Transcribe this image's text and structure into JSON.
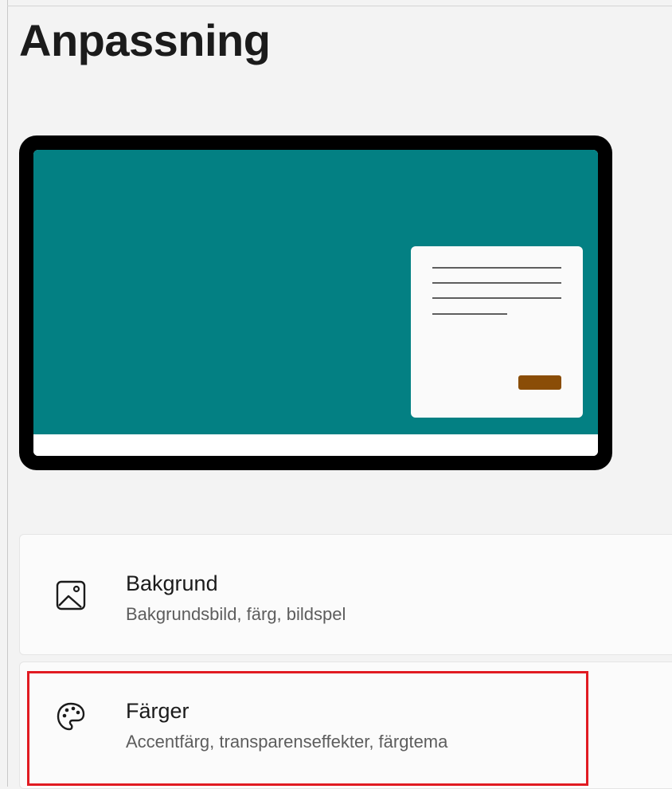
{
  "page": {
    "title": "Anpassning"
  },
  "preview": {
    "desktop_color": "#038083",
    "accent_button_color": "#8a4d07"
  },
  "settings": [
    {
      "title": "Bakgrund",
      "description": "Bakgrundsbild, färg, bildspel",
      "icon": "image-icon"
    },
    {
      "title": "Färger",
      "description": "Accentfärg, transparenseffekter, färgtema",
      "icon": "palette-icon",
      "highlighted": true
    }
  ],
  "highlight_color": "#e11b22"
}
